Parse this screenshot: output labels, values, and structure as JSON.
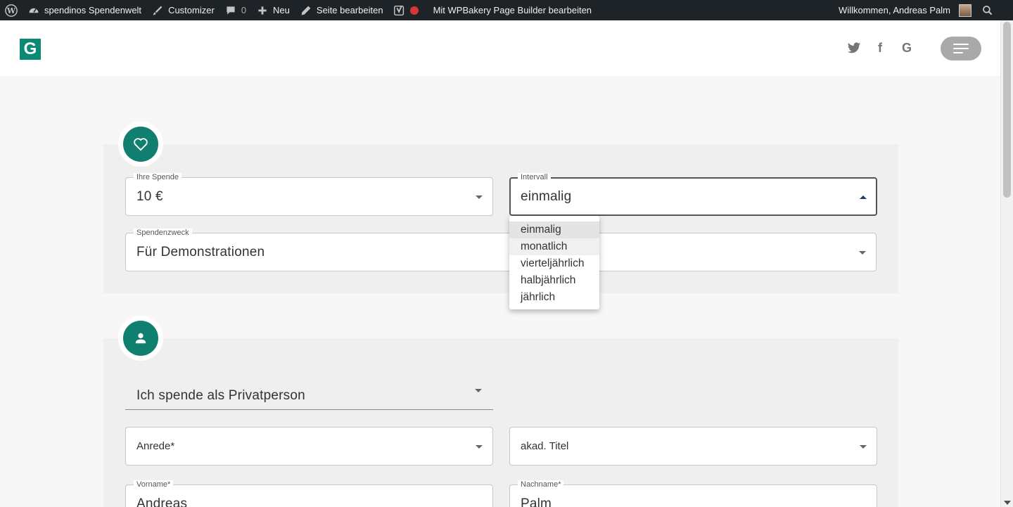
{
  "adminbar": {
    "site_name": "spendinos Spendenwelt",
    "customizer": "Customizer",
    "comments_count": "0",
    "new": "Neu",
    "edit_page": "Seite bearbeiten",
    "wpbakery": "Mit WPBakery Page Builder bearbeiten",
    "welcome": "Willkommen, Andreas Palm"
  },
  "header": {
    "logo_letter": "G",
    "social": [
      "twitter-icon",
      "facebook-icon",
      "google-icon"
    ],
    "google_glyph": "G",
    "facebook_glyph": "f"
  },
  "donation": {
    "amount_label": "Ihre Spende",
    "amount_value": "10 €",
    "interval_label": "Intervall",
    "interval_value": "einmalig",
    "purpose_label": "Spendenzweck",
    "purpose_value": "Für Demonstrationen",
    "interval_options": [
      "einmalig",
      "monatlich",
      "vierteljährlich",
      "halbjährlich",
      "jährlich"
    ]
  },
  "person": {
    "donor_type": "Ich spende als Privatperson",
    "salutation_placeholder": "Anrede*",
    "title_placeholder": "akad. Titel",
    "firstname_label": "Vorname*",
    "firstname_value": "Andreas",
    "lastname_label": "Nachname*",
    "lastname_value": "Palm"
  },
  "colors": {
    "accent": "#117f6f",
    "adminbar": "#1d2327"
  }
}
